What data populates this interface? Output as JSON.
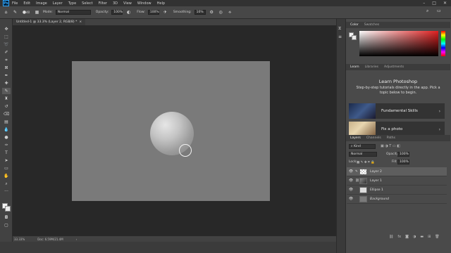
{
  "app": {
    "logo": "Ps"
  },
  "menu": [
    "File",
    "Edit",
    "Image",
    "Layer",
    "Type",
    "Select",
    "Filter",
    "3D",
    "View",
    "Window",
    "Help"
  ],
  "window_controls": [
    "–",
    "□",
    "✕"
  ],
  "options": {
    "mode_label": "Mode:",
    "mode_value": "Normal",
    "opacity_label": "Opacity:",
    "opacity_value": "100%",
    "flow_label": "Flow:",
    "flow_value": "100%",
    "smoothing_label": "Smoothing:",
    "smoothing_value": "10%",
    "brush_size": "40"
  },
  "document": {
    "tab_title": "Untitled-1 @ 33.3% (Layer 2, RGB/8) *",
    "close": "×"
  },
  "status": {
    "zoom": "33.33%",
    "doc": "Doc: 6.59M/21.4M"
  },
  "color_panel": {
    "tabs": [
      "Color",
      "Swatches"
    ],
    "fg": "#f3f3f3",
    "bg": "#eaeaea"
  },
  "learn_panel": {
    "tabs": [
      "Learn",
      "Libraries",
      "Adjustments"
    ],
    "title": "Learn Photoshop",
    "description": "Step-by-step tutorials directly in the app. Pick a topic below to begin.",
    "cards": [
      {
        "label": "Fundamental Skills",
        "chevron": "›"
      },
      {
        "label": "Fix a photo",
        "chevron": "›"
      }
    ]
  },
  "layers_panel": {
    "tabs": [
      "Layers",
      "Channels",
      "Paths"
    ],
    "filter": "Kind",
    "blend": "Normal",
    "opacity_label": "Opacity:",
    "opacity_value": "100%",
    "lock_label": "Lock:",
    "fill_label": "Fill:",
    "fill_value": "100%",
    "layers": [
      {
        "name": "Layer 2",
        "selected": true
      },
      {
        "name": "Layer 1",
        "selected": false
      },
      {
        "name": "Ellipse 1",
        "selected": false
      },
      {
        "name": "Background",
        "selected": false
      }
    ],
    "bottom_icons": [
      "link-icon",
      "fx-icon",
      "mask-icon",
      "adjustment-icon",
      "folder-icon",
      "new-layer-icon",
      "trash-icon"
    ]
  }
}
